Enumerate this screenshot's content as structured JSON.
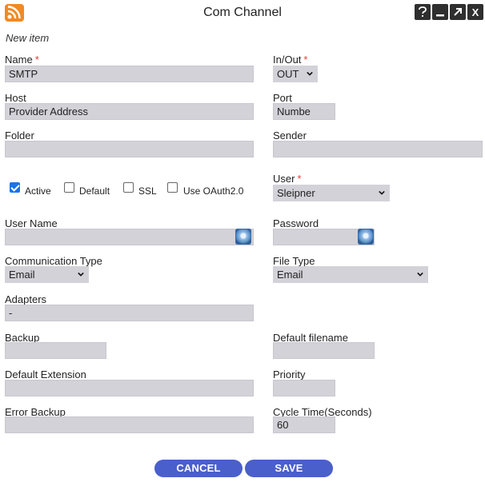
{
  "window": {
    "title": "Com Channel",
    "controls": [
      "help",
      "minimize",
      "popout",
      "close"
    ],
    "close_label": "X"
  },
  "form": {
    "subtitle": "New item",
    "name": {
      "label": "Name",
      "value": "SMTP",
      "required": true
    },
    "in_out": {
      "label": "In/Out",
      "value": "OUT",
      "required": true
    },
    "host": {
      "label": "Host",
      "placeholder": "Provider Address"
    },
    "port": {
      "label": "Port",
      "placeholder": "Numbe"
    },
    "folder": {
      "label": "Folder",
      "value": ""
    },
    "sender": {
      "label": "Sender",
      "value": ""
    },
    "checkboxes": [
      {
        "label": "Active",
        "checked": true
      },
      {
        "label": "Default",
        "checked": false
      },
      {
        "label": "SSL",
        "checked": false
      },
      {
        "label": "Use OAuth2.0",
        "checked": false
      }
    ],
    "user": {
      "label": "User",
      "value": "Sleipner",
      "required": true
    },
    "user_name": {
      "label": "User Name",
      "value": ""
    },
    "password": {
      "label": "Password",
      "value": ""
    },
    "communication_type": {
      "label": "Communication Type",
      "value": "Email"
    },
    "file_type": {
      "label": "File Type",
      "value": "Email"
    },
    "adapters": {
      "label": "Adapters",
      "value": "-"
    },
    "backup": {
      "label": "Backup",
      "value": ""
    },
    "default_filename": {
      "label": "Default filename",
      "value": ""
    },
    "default_extension": {
      "label": "Default Extension",
      "value": ""
    },
    "priority": {
      "label": "Priority",
      "value": ""
    },
    "error_backup": {
      "label": "Error Backup",
      "value": ""
    },
    "cycle_time": {
      "label": "Cycle Time(Seconds)",
      "value": "60"
    }
  },
  "buttons": {
    "cancel": "CANCEL",
    "save": "SAVE"
  },
  "colors": {
    "accent": "#4a5fcb",
    "required": "#e23b3b",
    "field_bg": "#d2d2d8",
    "rss": "#f08a24"
  }
}
